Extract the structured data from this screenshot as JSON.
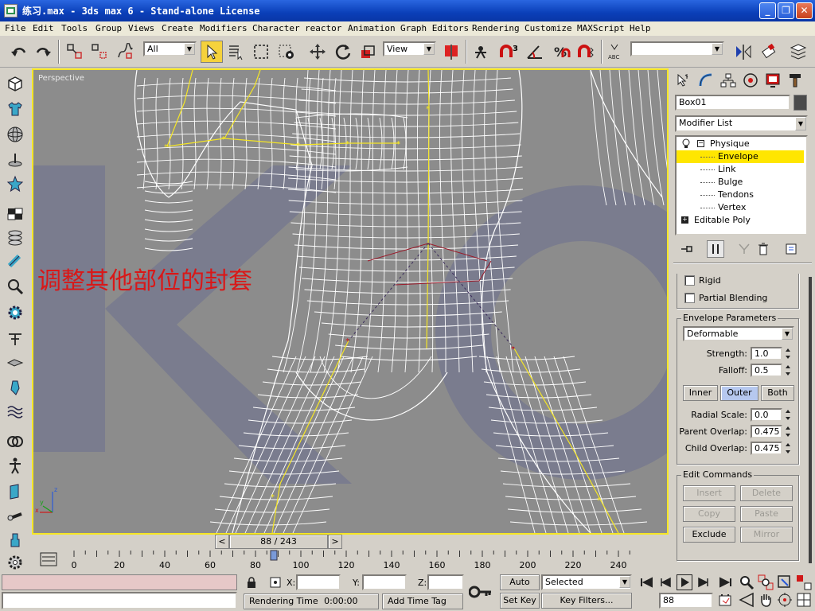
{
  "window": {
    "title": "练习.max - 3ds max 6 - Stand-alone License",
    "minimize_label": "_",
    "maximize_label": "❐",
    "close_label": "✕"
  },
  "menu": [
    "File",
    "Edit",
    "Tools",
    "Group",
    "Views",
    "Create",
    "Modifiers",
    "Character",
    "reactor",
    "Animation",
    "Graph Editors",
    "Rendering",
    "Customize",
    "MAXScript",
    "Help"
  ],
  "toolbar": {
    "selection_filter": "All",
    "reference_coord": "View",
    "named_selection": ""
  },
  "viewport": {
    "label": "Perspective",
    "annotation": "调整其他部位的封套",
    "axis_x": "x",
    "axis_y": "y",
    "axis_z": "z"
  },
  "command_panel": {
    "object_name": "Box01",
    "object_color": "#4a4a4a",
    "modifier_list_label": "Modifier List",
    "stack": {
      "physique": "Physique",
      "envelope": "Envelope",
      "link": "Link",
      "bulge": "Bulge",
      "tendons": "Tendons",
      "vertex": "Vertex",
      "editable_poly": "Editable Poly"
    },
    "rigid_label": "Rigid",
    "partial_blending_label": "Partial Blending",
    "envelope_params": {
      "title": "Envelope Parameters",
      "type": "Deformable",
      "strength_label": "Strength:",
      "strength": "1.0",
      "falloff_label": "Falloff:",
      "falloff": "0.5",
      "inner": "Inner",
      "outer": "Outer",
      "both": "Both",
      "radial_scale_label": "Radial Scale:",
      "radial_scale": "0.0",
      "parent_overlap_label": "Parent Overlap:",
      "parent_overlap": "0.475",
      "child_overlap_label": "Child Overlap:",
      "child_overlap": "0.475"
    },
    "edit_commands": {
      "title": "Edit Commands",
      "insert": "Insert",
      "delete": "Delete",
      "copy": "Copy",
      "paste": "Paste",
      "exclude": "Exclude",
      "mirror": "Mirror"
    }
  },
  "time_slider": {
    "frame_display": "88 / 243",
    "prev": "<",
    "next": ">"
  },
  "trackbar": {
    "ticks": [
      "0",
      "20",
      "40",
      "60",
      "80",
      "100",
      "120",
      "140",
      "160",
      "180",
      "200",
      "220",
      "240"
    ]
  },
  "status": {
    "x_label": "X:",
    "y_label": "Y:",
    "z_label": "Z:",
    "rendering_time_label": "Rendering Time",
    "rendering_time": "0:00:00",
    "add_time_tag": "Add Time Tag",
    "auto_key": "Auto Key",
    "set_key": "Set Key",
    "key_mode": "Selected",
    "key_filters": "Key Filters...",
    "current_frame": "88"
  }
}
